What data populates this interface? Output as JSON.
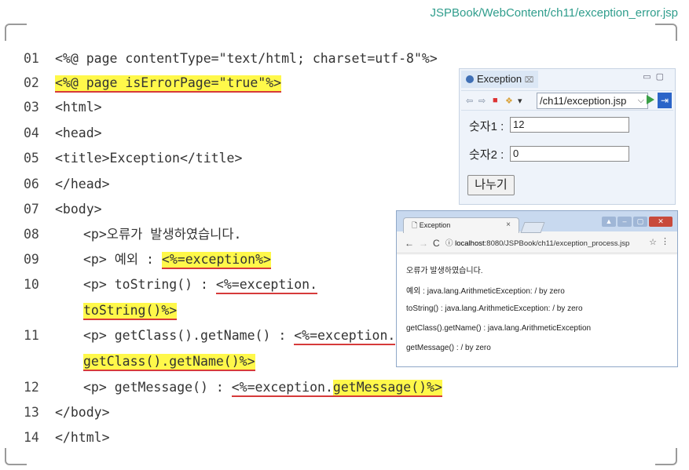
{
  "file_path": "JSPBook/WebContent/ch11/exception_error.jsp",
  "code_lines": [
    {
      "num": "01",
      "text": "<%@ page contentType=\"text/html; charset=utf-8\"%>"
    },
    {
      "num": "02",
      "text": "<%@ page isErrorPage=\"true\"%>"
    },
    {
      "num": "03",
      "text": "<html>"
    },
    {
      "num": "04",
      "text": "<head>"
    },
    {
      "num": "05",
      "text": "<title>Exception</title>"
    },
    {
      "num": "06",
      "text": "</head>"
    },
    {
      "num": "07",
      "text": "<body>"
    },
    {
      "num": "08",
      "text": "<p>오류가 발생하였습니다."
    },
    {
      "num": "09",
      "pre": "<p> 예외 : ",
      "hl": "<%=exception%>"
    },
    {
      "num": "10",
      "pre": "<p> toString() : ",
      "ul": "<%=exception.",
      "cont_hl": "toString()%>"
    },
    {
      "num": "11",
      "pre": "<p> getClass().getName() : ",
      "ul": "<%=exception.",
      "cont_hl": "getClass().getName()%>"
    },
    {
      "num": "12",
      "pre": "<p> getMessage() : ",
      "ul": "<%=exception.",
      "hl": "getMessage()%>"
    },
    {
      "num": "13",
      "text": "</body>"
    },
    {
      "num": "14",
      "text": "</html>"
    }
  ],
  "eclipse": {
    "tab_title": "Exception",
    "tab_close": "⌧",
    "url": "/ch11/exception.jsp",
    "label1": "숫자1 :",
    "value1": "12",
    "label2": "숫자2 :",
    "value2": "0",
    "button": "나누기"
  },
  "chrome": {
    "tab_title": "Exception",
    "tab_close": "×",
    "address_host": "localhost",
    "address_rest": ":8080/JSPBook/ch11/exception_process.jsp",
    "lines": [
      "오류가 발생하였습니다.",
      "예외 : java.lang.ArithmeticException: / by zero",
      "toString() : java.lang.ArithmeticException: / by zero",
      "getClass().getName() : java.lang.ArithmeticException",
      "getMessage() : / by zero"
    ]
  }
}
